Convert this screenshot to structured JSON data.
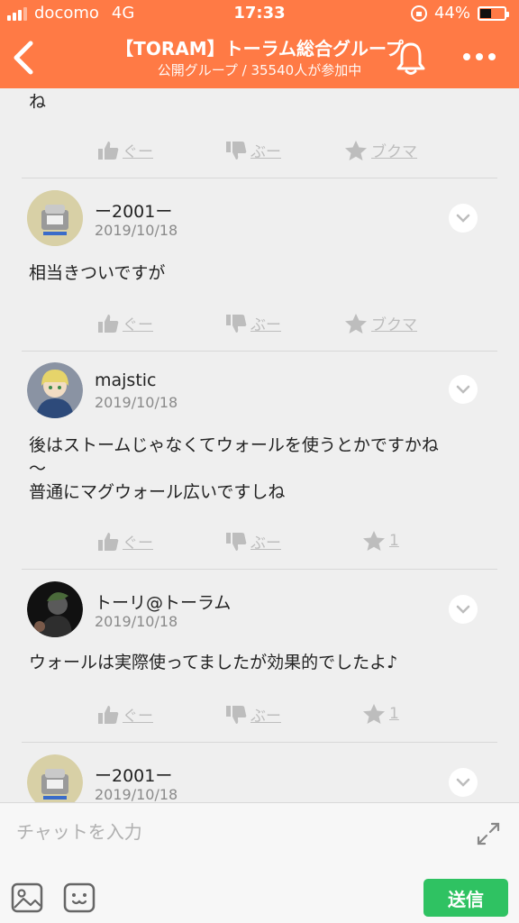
{
  "status_bar": {
    "carrier": "docomo",
    "network": "4G",
    "time": "17:33",
    "battery": "44%"
  },
  "nav": {
    "title": "【TORAM】トーラム総合グループ",
    "subtitle": "公開グループ / 35540人が参加中"
  },
  "labels": {
    "like": "ぐー",
    "dislike": "ぶー",
    "bookmark": "ブクマ"
  },
  "feed": {
    "top_fragment": "ね",
    "posts": [
      {
        "name": "ー2001ー",
        "date": "2019/10/18",
        "message": "相当きついですが",
        "bookmark": "ブクマ"
      },
      {
        "name": "majstic",
        "date": "2019/10/18",
        "message_lines": [
          "後はストームじゃなくてウォールを使うとかですかね",
          "〜",
          "普通にマグウォール広いですしね"
        ],
        "bookmark": "1"
      },
      {
        "name": "トーリ@トーラム",
        "date": "2019/10/18",
        "message": "ウォールは実際使ってましたが効果的でしたよ♪",
        "bookmark": "1"
      },
      {
        "name": "ー2001ー",
        "date": "2019/10/18"
      }
    ]
  },
  "composer": {
    "placeholder": "チャットを入力",
    "send_label": "送信"
  },
  "colors": {
    "header": "#ff7a45",
    "send": "#2fc262",
    "action": "#bdbdbd"
  }
}
